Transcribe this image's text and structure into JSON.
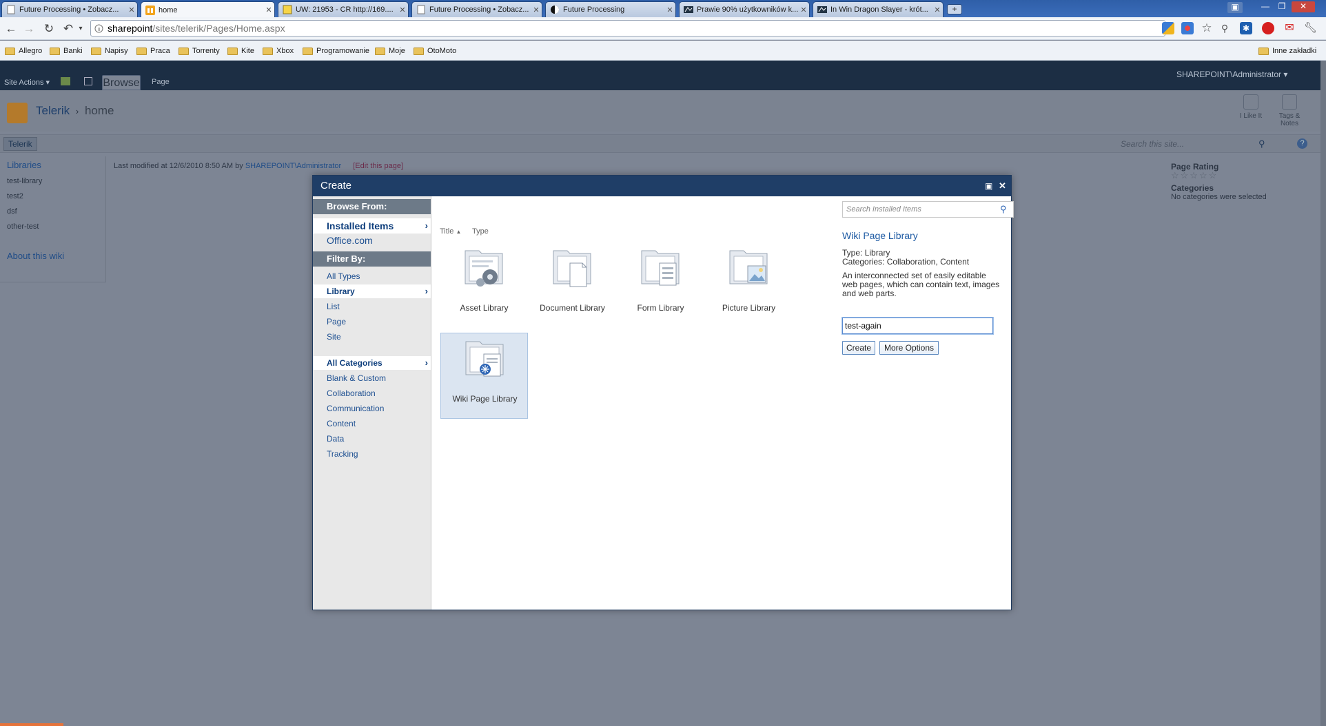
{
  "browser": {
    "tabs": [
      {
        "title": "Future Processing • Zobacz...",
        "icon": "page-icon"
      },
      {
        "title": "home",
        "icon": "sharepoint-icon",
        "active": true
      },
      {
        "title": "UW: 21953 - CR http://169....",
        "icon": "notes-icon"
      },
      {
        "title": "Future Processing • Zobacz...",
        "icon": "page-icon"
      },
      {
        "title": "Future Processing",
        "icon": "future-processing-icon"
      },
      {
        "title": "Prawie 90% użytkowników k...",
        "icon": "pc-site-icon"
      },
      {
        "title": "In Win Dragon Slayer - krót...",
        "icon": "pc-site-icon"
      }
    ],
    "url_host": "sharepoint",
    "url_path": "/sites/telerik/Pages/Home.aspx",
    "bookmarks": [
      "Allegro",
      "Banki",
      "Napisy",
      "Praca",
      "Torrenty",
      "Kite",
      "Xbox",
      "Programowanie",
      "Moje",
      "OtoMoto"
    ],
    "other_bookmarks": "Inne zakładki"
  },
  "sharepoint": {
    "site_actions": "Site Actions",
    "ribbon_tabs": [
      "Browse",
      "Page"
    ],
    "user": "SHAREPOINT\\Administrator",
    "site_title": "Telerik",
    "breadcrumb_sep": "›",
    "page_title": "home",
    "i_like_it": "I Like It",
    "tags_notes": "Tags & Notes",
    "top_nav_tab": "Telerik",
    "search_placeholder": "Search this site...",
    "left_nav": {
      "header": "Libraries",
      "items": [
        "test-library",
        "test2",
        "dsf",
        "other-test"
      ],
      "about": "About this wiki"
    },
    "last_modified": "Last modified at 12/6/2010 8:50 AM by",
    "last_modified_user": "SHAREPOINT\\Administrator",
    "edit_link": "[Edit this page]",
    "page_rating_label": "Page Rating",
    "categories_label": "Categories",
    "categories_value": "No categories were selected"
  },
  "dialog": {
    "title": "Create",
    "browse_from": "Browse From:",
    "browse_items": [
      {
        "label": "Installed Items",
        "selected": true
      },
      {
        "label": "Office.com"
      }
    ],
    "filter_by": "Filter By:",
    "type_filters": [
      {
        "label": "All Types"
      },
      {
        "label": "Library",
        "selected": true
      },
      {
        "label": "List"
      },
      {
        "label": "Page"
      },
      {
        "label": "Site"
      }
    ],
    "category_filters": [
      {
        "label": "All Categories",
        "selected": true
      },
      {
        "label": "Blank & Custom"
      },
      {
        "label": "Collaboration"
      },
      {
        "label": "Communication"
      },
      {
        "label": "Content"
      },
      {
        "label": "Data"
      },
      {
        "label": "Tracking"
      }
    ],
    "sort_title": "Title",
    "sort_type": "Type",
    "templates": [
      {
        "label": "Asset Library",
        "icon": "asset-library-icon"
      },
      {
        "label": "Document Library",
        "icon": "document-library-icon"
      },
      {
        "label": "Form Library",
        "icon": "form-library-icon"
      },
      {
        "label": "Picture Library",
        "icon": "picture-library-icon"
      },
      {
        "label": "Wiki Page Library",
        "icon": "wiki-page-library-icon",
        "selected": true
      }
    ],
    "search_placeholder": "Search Installed Items",
    "detail_title": "Wiki Page Library",
    "detail_type": "Type: Library",
    "detail_categories": "Categories: Collaboration, Content",
    "detail_description": "An interconnected set of easily editable web pages, which can contain text, images and web parts.",
    "name_value": "test-again",
    "create_button": "Create",
    "more_options_button": "More Options"
  },
  "colors": {
    "dialog_title_bar": "#1f3e67",
    "filter_header": "#6d7a88",
    "link_blue": "#1d4f91",
    "overlay": "#7d8594"
  }
}
